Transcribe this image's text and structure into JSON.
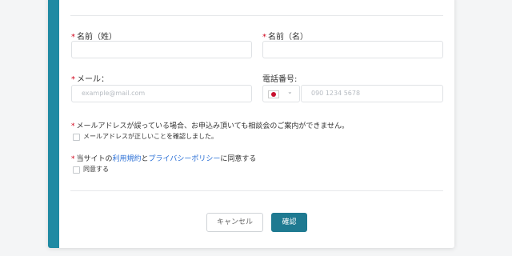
{
  "form": {
    "last_name_label": "名前（姓）",
    "first_name_label": "名前（名）",
    "email_label": "メール：",
    "email_placeholder": "example@mail.com",
    "phone_label": "電話番号:",
    "phone_placeholder": "090 1234 5678",
    "required_mark": "*",
    "notice_text": "メールアドレスが誤っている場合、お申込み頂いても相談会のご案内ができません。",
    "email_confirm_label": "メールアドレスが正しいことを確認しました。",
    "terms_prefix": "当サイトの",
    "terms_link": "利用規約",
    "terms_and": "と",
    "privacy_link": "プライバシーポリシー",
    "terms_suffix": "に同意する",
    "agree_label": "同意する"
  },
  "buttons": {
    "cancel": "キャンセル",
    "confirm": "確認"
  },
  "colors": {
    "accent": "#1f8aa3",
    "primary_button": "#1f7a91",
    "required": "#d0021b",
    "link": "#2a6fd6"
  }
}
